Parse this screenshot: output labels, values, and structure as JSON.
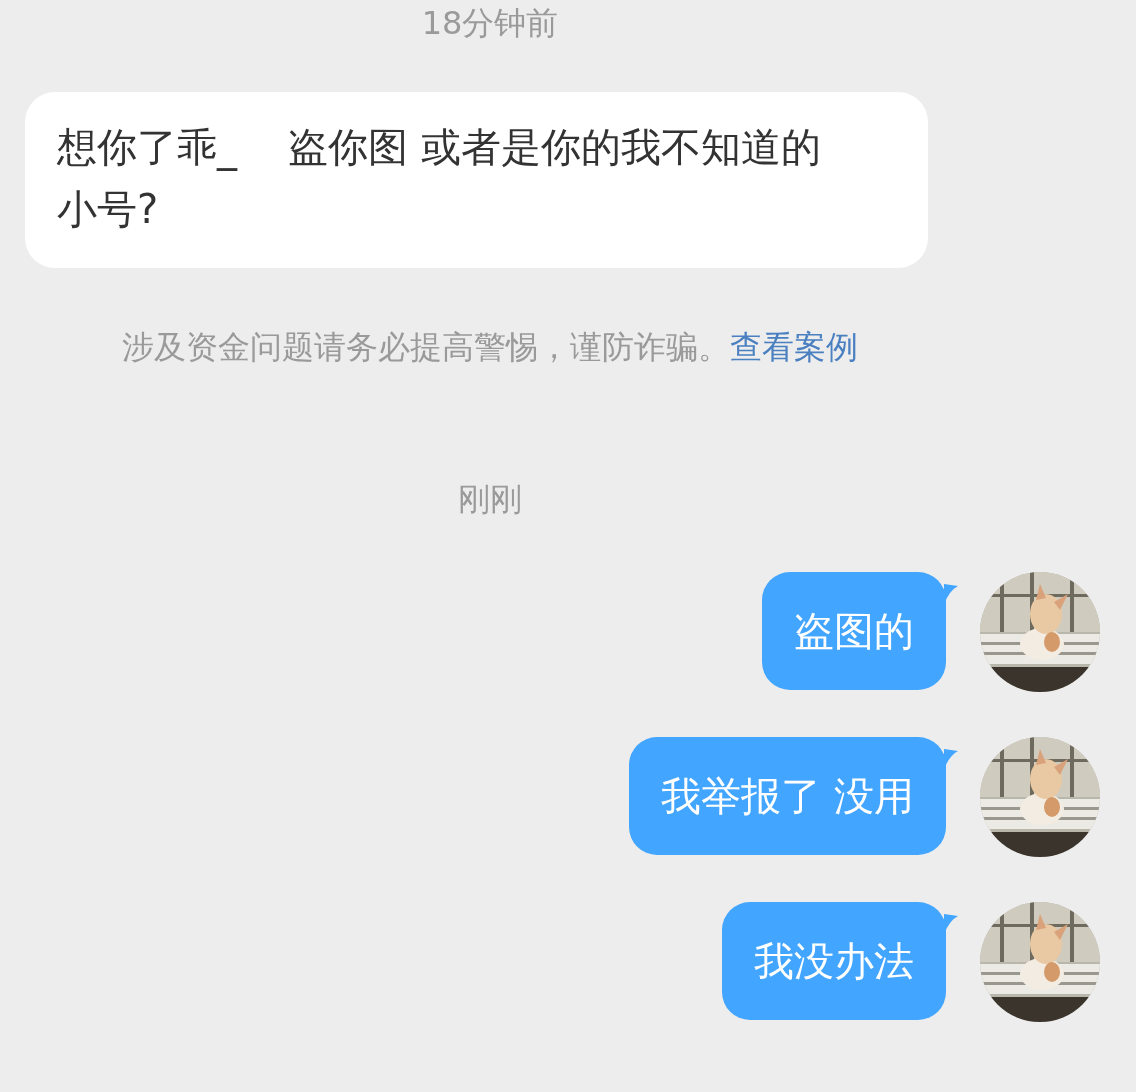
{
  "messages": [
    {
      "kind": "timestamp",
      "text": "18分钟前"
    },
    {
      "kind": "incoming",
      "text": "想你了乖_    盗你图 或者是你的我不知道的小号?"
    },
    {
      "kind": "notice",
      "text": "涉及资金问题请务必提高警惕，谨防诈骗。",
      "link": "查看案例"
    },
    {
      "kind": "timestamp",
      "text": "刚刚"
    },
    {
      "kind": "outgoing",
      "text": "盗图的"
    },
    {
      "kind": "outgoing",
      "text": "我举报了 没用"
    },
    {
      "kind": "outgoing",
      "text": "我没办法"
    }
  ]
}
